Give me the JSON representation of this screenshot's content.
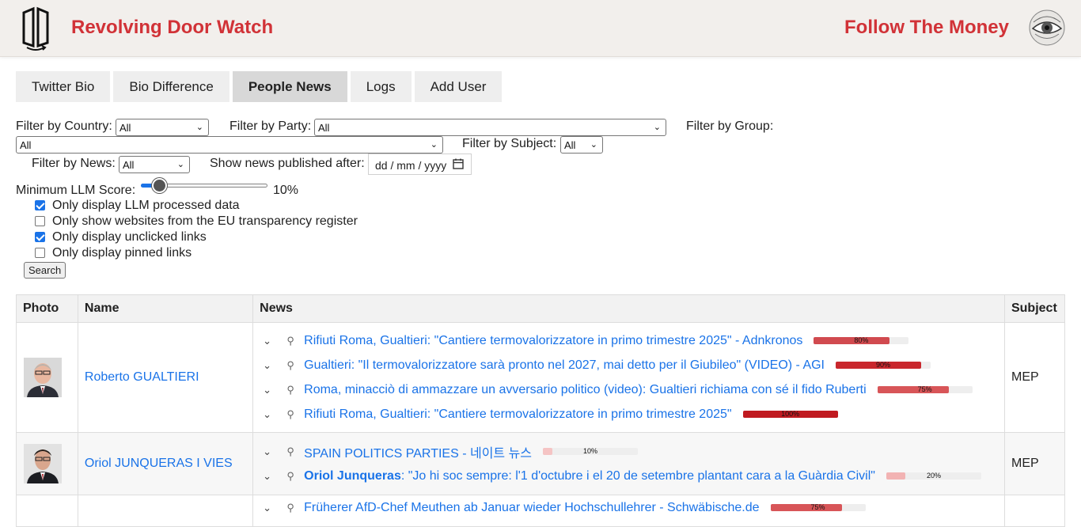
{
  "header": {
    "site_title": "Revolving Door Watch",
    "ftm_title": "Follow The Money",
    "logo_icon": "door-book-logo-icon",
    "eye_icon": "eye-logo-icon",
    "accent_color": "#d13237"
  },
  "tabs": [
    {
      "label": "Twitter Bio"
    },
    {
      "label": "Bio Difference"
    },
    {
      "label": "People News",
      "active": true
    },
    {
      "label": "Logs"
    },
    {
      "label": "Add User"
    }
  ],
  "filters": {
    "country": {
      "label": "Filter by Country:",
      "value": "All"
    },
    "party": {
      "label": "Filter by Party:",
      "value": "All"
    },
    "group": {
      "label": "Filter by Group:",
      "value": "All"
    },
    "subject": {
      "label": "Filter by Subject:",
      "value": "All"
    },
    "news": {
      "label": "Filter by News:",
      "value": "All"
    },
    "published_after": {
      "label": "Show news published after:",
      "placeholder": "dd / mm / yyyy"
    },
    "llm_score": {
      "label": "Minimum LLM Score:",
      "value_text": "10%",
      "value": 0.1
    },
    "checkboxes": [
      {
        "label": "Only display LLM processed data",
        "checked": true
      },
      {
        "label": "Only show websites from the EU transparency register",
        "checked": false
      },
      {
        "label": "Only display unclicked links",
        "checked": true
      },
      {
        "label": "Only display pinned links",
        "checked": false
      }
    ],
    "search_label": "Search"
  },
  "table": {
    "headers": [
      "Photo",
      "Name",
      "News",
      "Subject"
    ],
    "rows": [
      {
        "name": "Roberto GUALTIERI",
        "subject": "MEP",
        "news": [
          {
            "title": "Rifiuti Roma, Gualtieri: \"Cantiere termovalorizzatore in primo trimestre 2025\" - Adnkronos",
            "score": 0.8,
            "score_text": "80%"
          },
          {
            "title": "Gualtieri: \"Il termovalorizzatore sarà pronto nel 2027, mai detto per il Giubileo\" (VIDEO) - AGI",
            "score": 0.9,
            "score_text": "90%"
          },
          {
            "title": "Roma, minacciò di ammazzare un avversario politico (video): Gualtieri richiama con sé il fido Ruberti",
            "score": 0.75,
            "score_text": "75%"
          },
          {
            "title": "Rifiuti Roma, Gualtieri: \"Cantiere termovalorizzatore in primo trimestre 2025\"",
            "score": 1.0,
            "score_text": "100%"
          }
        ]
      },
      {
        "name": "Oriol JUNQUERAS I VIES",
        "subject": "MEP",
        "news": [
          {
            "title": "SPAIN POLITICS PARTIES - 네이트 뉴스",
            "score": 0.1,
            "score_text": "10%"
          },
          {
            "title_bold": "Oriol Junqueras",
            "title": ": \"Jo hi soc sempre: l'1 d'octubre i el 20 de setembre plantant cara a la Guàrdia Civil\"",
            "score": 0.2,
            "score_text": "20%"
          }
        ]
      },
      {
        "name": "",
        "subject": "",
        "news": [
          {
            "title": "Früherer AfD-Chef Meuthen ab Januar wieder Hochschullehrer - Schwäbische.de",
            "score": 0.75,
            "score_text": "75%"
          }
        ]
      }
    ]
  }
}
